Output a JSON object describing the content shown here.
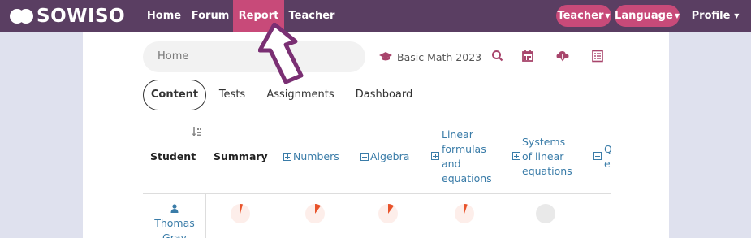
{
  "navbar": {
    "logo_text": "SOWISO",
    "links": {
      "home": "Home",
      "forum": "Forum",
      "report": "Report",
      "teacher": "Teacher"
    },
    "teacher_pill": "Teacher",
    "language_pill": "Language",
    "profile": "Profile",
    "colors": {
      "bar": "#5a3e62",
      "accent": "#c84a79"
    }
  },
  "toolbar": {
    "search_placeholder": "Home",
    "course_name": "Basic Math 2023",
    "icons": [
      "graduation-cap-icon",
      "search-icon",
      "calendar-icon",
      "cloud-download-icon",
      "list-icon"
    ]
  },
  "tabs": {
    "content": "Content",
    "tests": "Tests",
    "assignments": "Assignments",
    "dashboard": "Dashboard"
  },
  "table": {
    "headers": {
      "student": "Student",
      "summary": "Summary",
      "numbers": "Numbers",
      "algebra": "Algebra",
      "linear_formulas": [
        "Linear",
        "formulas",
        "and",
        "equations"
      ],
      "systems": [
        "Systems",
        "of linear",
        "equations"
      ],
      "cut_col": [
        "Q",
        "e"
      ]
    },
    "rows": [
      {
        "student": [
          "Thomas",
          "Gray"
        ],
        "progress": [
          0.04,
          0.1,
          0.1,
          0.05,
          0
        ]
      }
    ]
  },
  "annotation": {
    "arrow_color": "#7a2f73"
  }
}
